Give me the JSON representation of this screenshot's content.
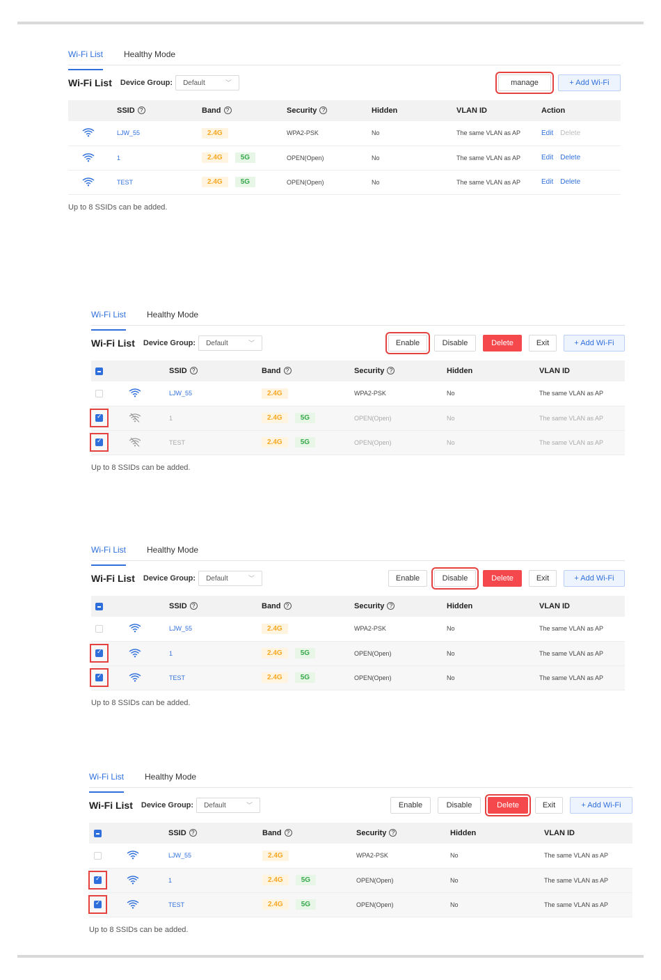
{
  "tabs": [
    "Wi-Fi List",
    "Healthy Mode"
  ],
  "title": "Wi-Fi List",
  "device_group_label": "Device Group:",
  "device_group_value": "Default",
  "buttons": {
    "manage": "manage",
    "add": "+ Add Wi-Fi",
    "enable": "Enable",
    "disable": "Disable",
    "delete": "Delete",
    "exit": "Exit"
  },
  "columns": {
    "ssid": "SSID",
    "band": "Band",
    "security": "Security",
    "hidden": "Hidden",
    "vlan": "VLAN ID",
    "action": "Action"
  },
  "actions": {
    "edit": "Edit",
    "delete": "Delete"
  },
  "rows": [
    {
      "ssid": "LJW_55",
      "band": [
        "2.4G"
      ],
      "security": "WPA2-PSK",
      "hidden": "No",
      "vlan": "The same VLAN as AP"
    },
    {
      "ssid": "1",
      "band": [
        "2.4G",
        "5G"
      ],
      "security": "OPEN(Open)",
      "hidden": "No",
      "vlan": "The same VLAN as AP"
    },
    {
      "ssid": "TEST",
      "band": [
        "2.4G",
        "5G"
      ],
      "security": "OPEN(Open)",
      "hidden": "No",
      "vlan": "The same VLAN as AP"
    }
  ],
  "note": "Up to 8 SSIDs can be added.",
  "colors": {
    "accent": "#2f6fdc",
    "delete": "#f5484d",
    "highlight": "#e5413f",
    "band24": "#f7a823",
    "band5": "#35a849"
  },
  "icons": [
    "wifi-icon",
    "wifi-off-icon",
    "help-circle-icon",
    "chevron-down-icon",
    "checkbox-icon"
  ]
}
